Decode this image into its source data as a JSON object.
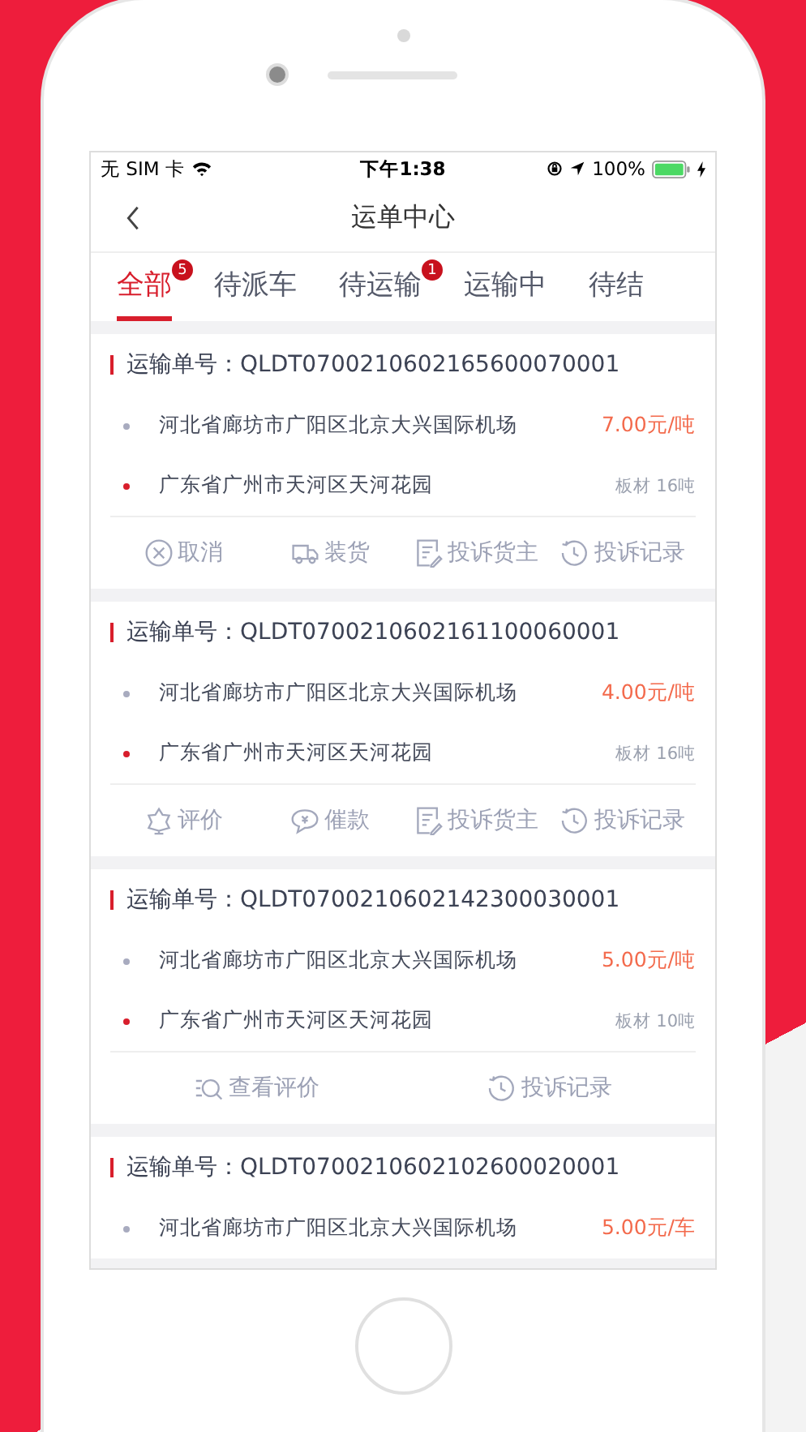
{
  "status_bar": {
    "carrier": "无 SIM 卡",
    "time": "下午1:38",
    "battery": "100%"
  },
  "nav": {
    "title": "运单中心"
  },
  "tabs": [
    {
      "label": "全部",
      "selected": true,
      "badge": "5"
    },
    {
      "label": "待派车",
      "selected": false
    },
    {
      "label": "待运输",
      "selected": false,
      "badge": "1"
    },
    {
      "label": "运输中",
      "selected": false
    },
    {
      "label": "待结",
      "selected": false
    }
  ],
  "orders": [
    {
      "order_no": "运输单号：QLDT0700210602165600070001",
      "from": "河北省廊坊市广阳区北京大兴国际机场",
      "price": "7.00元/吨",
      "to": "广东省广州市天河区天河花园",
      "cargo": "板材 16吨",
      "actions": [
        {
          "kind": "cancel",
          "label": "取消"
        },
        {
          "kind": "load",
          "label": "装货"
        },
        {
          "kind": "complain",
          "label": "投诉货主"
        },
        {
          "kind": "history",
          "label": "投诉记录"
        }
      ]
    },
    {
      "order_no": "运输单号：QLDT0700210602161100060001",
      "from": "河北省廊坊市广阳区北京大兴国际机场",
      "price": "4.00元/吨",
      "to": "广东省广州市天河区天河花园",
      "cargo": "板材 16吨",
      "actions": [
        {
          "kind": "rate",
          "label": "评价"
        },
        {
          "kind": "urge",
          "label": "催款"
        },
        {
          "kind": "complain",
          "label": "投诉货主"
        },
        {
          "kind": "history",
          "label": "投诉记录"
        }
      ]
    },
    {
      "order_no": "运输单号：QLDT0700210602142300030001",
      "from": "河北省廊坊市广阳区北京大兴国际机场",
      "price": "5.00元/吨",
      "to": "广东省广州市天河区天河花园",
      "cargo": "板材 10吨",
      "actions": [
        {
          "kind": "view_rating",
          "label": "查看评价"
        },
        {
          "kind": "history",
          "label": "投诉记录"
        }
      ]
    },
    {
      "order_no": "运输单号：QLDT0700210602102600020001",
      "from": "河北省廊坊市广阳区北京大兴国际机场",
      "price": "5.00元/车"
    }
  ]
}
